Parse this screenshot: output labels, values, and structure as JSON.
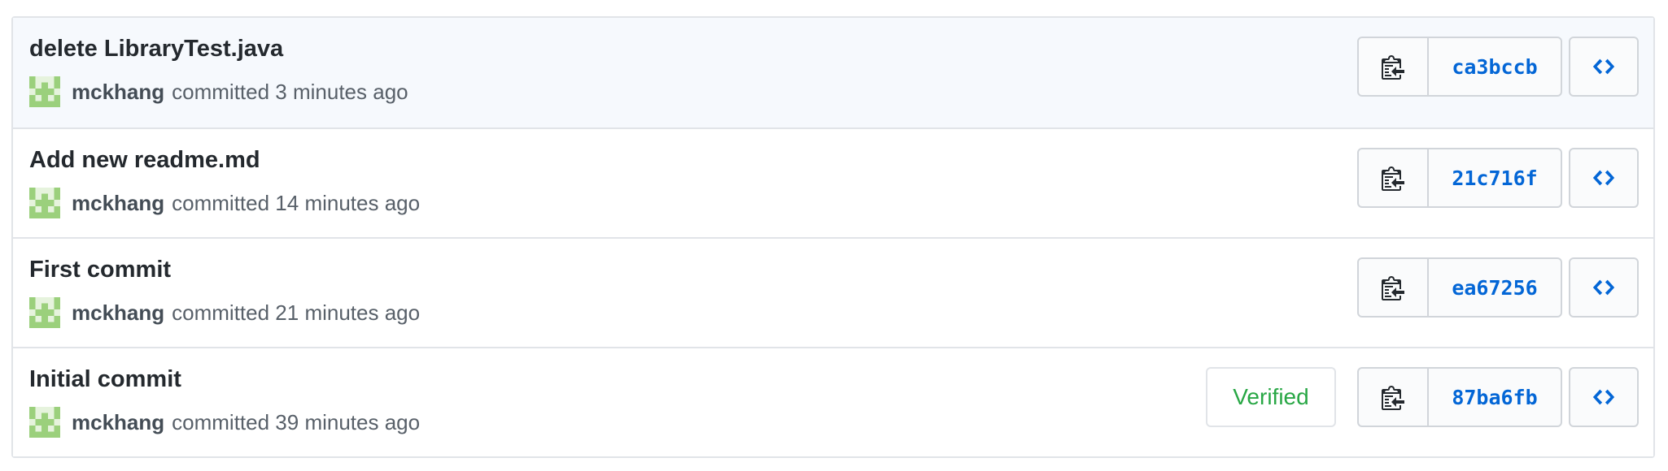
{
  "commits": [
    {
      "title": "delete LibraryTest.java",
      "author": "mckhang",
      "time_text": "committed 3 minutes ago",
      "sha": "ca3bccb",
      "verified": false
    },
    {
      "title": "Add new readme.md",
      "author": "mckhang",
      "time_text": "committed 14 minutes ago",
      "sha": "21c716f",
      "verified": false
    },
    {
      "title": "First commit",
      "author": "mckhang",
      "time_text": "committed 21 minutes ago",
      "sha": "ea67256",
      "verified": false
    },
    {
      "title": "Initial commit",
      "author": "mckhang",
      "time_text": "committed 39 minutes ago",
      "sha": "87ba6fb",
      "verified": true,
      "verified_label": "Verified"
    }
  ],
  "icons": {
    "avatar": "identicon-avatar",
    "copy": "clipboard-icon",
    "browse": "code-icon"
  },
  "colors": {
    "link": "#0366d6",
    "verified": "#28a745",
    "highlight_row": "#f6f9fd",
    "avatar": "#9bd07c"
  }
}
